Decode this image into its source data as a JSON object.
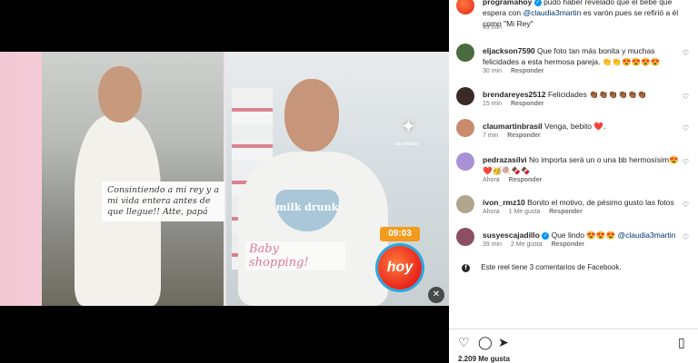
{
  "media": {
    "caption_overlay": "Consintiendo a mi rey y a mi vida entera antes de que llegue!! Atte, papá",
    "bib_text": "milk drunk",
    "sticker_text": "Baby shopping!",
    "sparkle_label": "las estrellas",
    "time_badge": "09:03",
    "logo_text": "hoy",
    "mute_icon": "speaker-muted-icon"
  },
  "post": {
    "author": "programahoy",
    "caption_part1": "pudo haber revelado que el bebé que espera con",
    "caption_mention": "@claudia3martin",
    "caption_part2": "es varón pues se refirió a él como \"Mi Rey\"",
    "time": "49 min"
  },
  "comments": [
    {
      "user": "eljackson7590",
      "text": "Que foto tan más bonita y muchas felicidades a esta hermosa pareja. 👏👏😍😍😍😍",
      "time": "30 min",
      "reply": "Responder",
      "avatar_color": "#4a6b3d"
    },
    {
      "user": "brendareyes2512",
      "text": "Felicidades 👏🏾👏🏾👏🏾👏🏾👏🏾👏🏾",
      "time": "15 min",
      "reply": "Responder",
      "avatar_color": "#3a2a26"
    },
    {
      "user": "claumartinbrasil",
      "text": "Venga, bebito ❤️.",
      "time": "7 min",
      "reply": "Responder",
      "avatar_color": "#c98b6e"
    },
    {
      "user": "pedrazasilvi",
      "text": "No importa será un o una bb hermosísim😍❤️🥳🍭🍫🍫",
      "time": "Ahora",
      "reply": "Responder",
      "avatar_color": "#a891d6"
    },
    {
      "user": "ivon_rmz10",
      "text": "Bonito el motivo, de pésimo gusto las fotos",
      "time": "Ahora",
      "likes": "1 Me gusta",
      "reply": "Responder",
      "avatar_color": "#b0a58f"
    },
    {
      "user": "susyescajadillo",
      "text_pre": "Que lindo 😍😍😍",
      "mention": "@claudia3martin",
      "time": "39 min",
      "likes": "2 Me gusta",
      "reply": "Responder",
      "avatar_color": "#8c4e63"
    }
  ],
  "facebook": {
    "icon": "facebook-icon",
    "text": "Este reel tiene 3 comentarios de Facebook."
  },
  "actions": {
    "like_icon": "heart-icon",
    "comment_icon": "comment-icon",
    "share_icon": "share-icon",
    "save_icon": "bookmark-icon",
    "likes_count": "2.209 Me gusta"
  },
  "colors": {
    "link": "#00376b",
    "verified": "#0095f6",
    "badge": "#f29c1f"
  }
}
